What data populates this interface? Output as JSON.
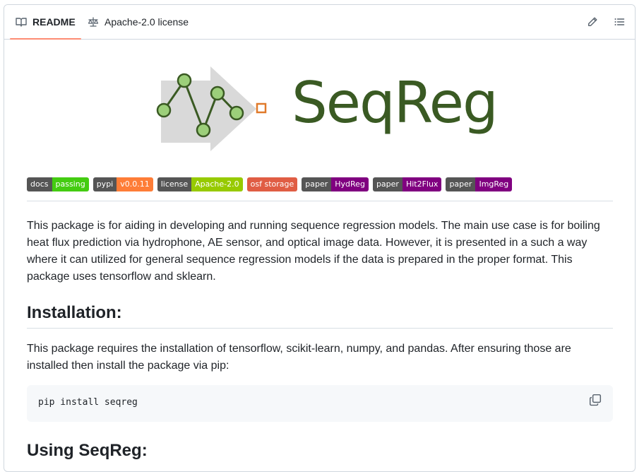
{
  "tabs": {
    "readme": "README",
    "license": "Apache-2.0 license"
  },
  "icons": {
    "readme": "book-icon",
    "license": "scale-icon",
    "edit": "pencil-icon",
    "outline": "list-unordered-icon",
    "copy": "copy-icon"
  },
  "banner": {
    "title": "SeqReg"
  },
  "badges": [
    {
      "label": "docs",
      "message": "passing",
      "color": "#4c1"
    },
    {
      "label": "pypi",
      "message": "v0.0.11",
      "color": "#fe7d37"
    },
    {
      "label": "license",
      "message": "Apache-2.0",
      "color": "#97ca00"
    },
    {
      "label": "",
      "message": "osf storage",
      "color": "#e05d44"
    },
    {
      "label": "paper",
      "message": "HydReg",
      "color": "#800080"
    },
    {
      "label": "paper",
      "message": "Hit2Flux",
      "color": "#800080"
    },
    {
      "label": "paper",
      "message": "ImgReg",
      "color": "#800080"
    }
  ],
  "intro": "This package is for aiding in developing and running sequence regression models. The main use case is for boiling heat flux prediction via hydrophone, AE sensor, and optical image data. However, it is presented in a such a way where it can utilized for general sequence regression models if the data is prepared in the proper format. This package uses tensorflow and sklearn.",
  "installation": {
    "heading": "Installation:",
    "text": "This package requires the installation of tensorflow, scikit-learn, numpy, and pandas. After ensuring those are installed then install the package via pip:",
    "code": "pip install seqreg"
  },
  "using": {
    "heading": "Using SeqReg:"
  },
  "colors": {
    "accent_underline": "#fd8c73",
    "logo_green": "#3a5a23",
    "node_fill": "#9ccf7a",
    "arrow_gray": "#d9d9d9",
    "square_orange": "#e07a2b"
  }
}
